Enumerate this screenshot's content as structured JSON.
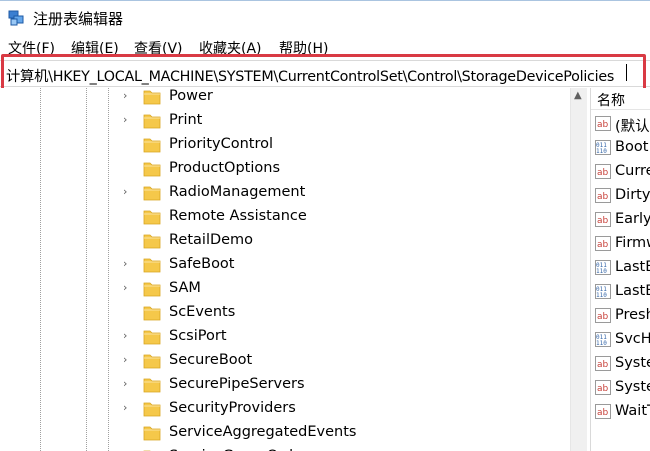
{
  "window": {
    "title": "注册表编辑器"
  },
  "menu": [
    "文件(F)",
    "编辑(E)",
    "查看(V)",
    "收藏夹(A)",
    "帮助(H)"
  ],
  "address": {
    "path": "计算机\\HKEY_LOCAL_MACHINE\\SYSTEM\\CurrentControlSet\\Control\\StorageDevicePolicies"
  },
  "tree": {
    "items": [
      {
        "label": "Power",
        "expandable": true
      },
      {
        "label": "Print",
        "expandable": true
      },
      {
        "label": "PriorityControl",
        "expandable": false
      },
      {
        "label": "ProductOptions",
        "expandable": false
      },
      {
        "label": "RadioManagement",
        "expandable": true
      },
      {
        "label": "Remote Assistance",
        "expandable": false
      },
      {
        "label": "RetailDemo",
        "expandable": false
      },
      {
        "label": "SafeBoot",
        "expandable": true
      },
      {
        "label": "SAM",
        "expandable": true
      },
      {
        "label": "ScEvents",
        "expandable": false
      },
      {
        "label": "ScsiPort",
        "expandable": true
      },
      {
        "label": "SecureBoot",
        "expandable": true
      },
      {
        "label": "SecurePipeServers",
        "expandable": true
      },
      {
        "label": "SecurityProviders",
        "expandable": true
      },
      {
        "label": "ServiceAggregatedEvents",
        "expandable": false
      },
      {
        "label": "ServiceGroupOrder",
        "expandable": true
      }
    ]
  },
  "values": {
    "header": "名称",
    "items": [
      {
        "label": "(默认)",
        "type": "string"
      },
      {
        "label": "Boot",
        "type": "binary"
      },
      {
        "label": "Curre",
        "type": "string"
      },
      {
        "label": "DirtyS",
        "type": "string"
      },
      {
        "label": "Early",
        "type": "string"
      },
      {
        "label": "Firmw",
        "type": "string"
      },
      {
        "label": "LastB",
        "type": "binary"
      },
      {
        "label": "LastB",
        "type": "binary"
      },
      {
        "label": "Presh",
        "type": "string"
      },
      {
        "label": "SvcHo",
        "type": "binary"
      },
      {
        "label": "Syste",
        "type": "string"
      },
      {
        "label": "Syste",
        "type": "string"
      },
      {
        "label": "WaitT",
        "type": "string"
      }
    ]
  },
  "colors": {
    "folder": "#f5c84a",
    "highlight": "#d93a44",
    "ab_icon": "#c8413a",
    "bin_icon": "#3466a8"
  }
}
